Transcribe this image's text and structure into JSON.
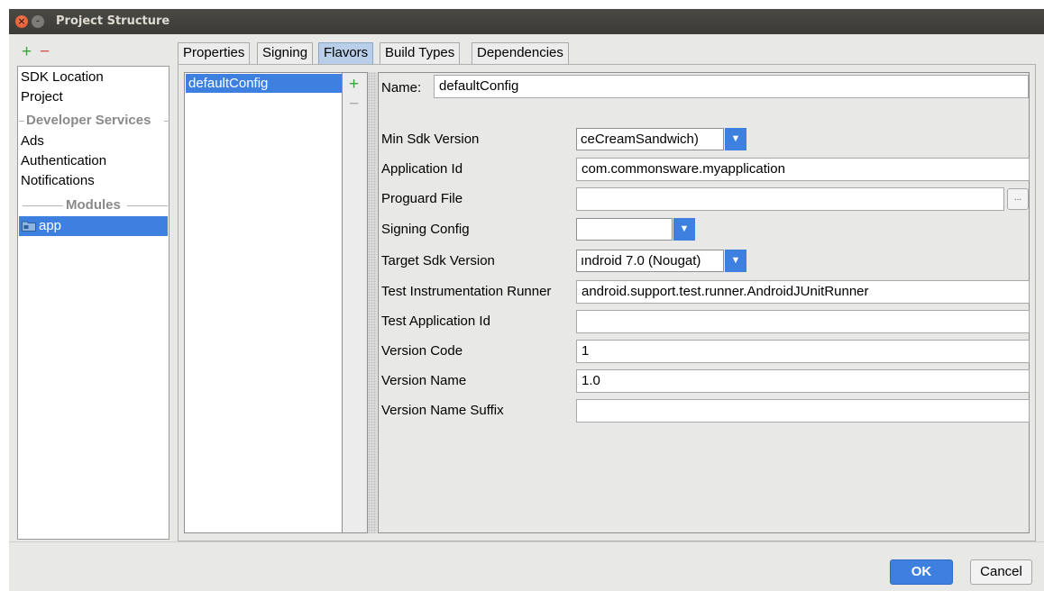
{
  "window": {
    "title": "Project Structure",
    "close_glyph": "×",
    "minimize_glyph": "–"
  },
  "toolbar": {
    "add_glyph": "+",
    "remove_glyph": "−"
  },
  "left_list": {
    "items_top": [
      "SDK Location",
      "Project"
    ],
    "developer_services_header": "Developer Services",
    "services": [
      "Ads",
      "Authentication",
      "Notifications"
    ],
    "modules_header": "Modules",
    "module": {
      "icon": "folder-module-icon",
      "label": "app"
    }
  },
  "tabs": [
    "Properties",
    "Signing",
    "Flavors",
    "Build Types",
    "Dependencies"
  ],
  "active_tab": "Flavors",
  "flavors": {
    "items": [
      "defaultConfig"
    ],
    "add_glyph": "+",
    "remove_glyph": "−"
  },
  "form": {
    "name_label": "Name:",
    "name_value": "defaultConfig",
    "min_sdk": {
      "label": "Min Sdk Version",
      "value": "ceCreamSandwich)"
    },
    "application_id": {
      "label": "Application Id",
      "value": "com.commonsware.myapplication"
    },
    "proguard_file": {
      "label": "Proguard File",
      "value": "",
      "browse_label": "..."
    },
    "signing_config": {
      "label": "Signing Config",
      "value": ""
    },
    "target_sdk": {
      "label": "Target Sdk Version",
      "value": "ındroid 7.0 (Nougat)"
    },
    "test_runner": {
      "label": "Test Instrumentation Runner",
      "value": "android.support.test.runner.AndroidJUnitRunner"
    },
    "test_app_id": {
      "label": "Test Application Id",
      "value": ""
    },
    "version_code": {
      "label": "Version Code",
      "value": "1"
    },
    "version_name": {
      "label": "Version Name",
      "value": "1.0"
    },
    "version_name_suffix": {
      "label": "Version Name Suffix",
      "value": ""
    },
    "combo_arrow": "▼"
  },
  "buttons": {
    "ok": "OK",
    "cancel": "Cancel"
  },
  "colors": {
    "accent": "#3d80df",
    "titlebar": "#3c3b37",
    "add_green": "#3aa53a",
    "remove_red": "#d9534f"
  }
}
